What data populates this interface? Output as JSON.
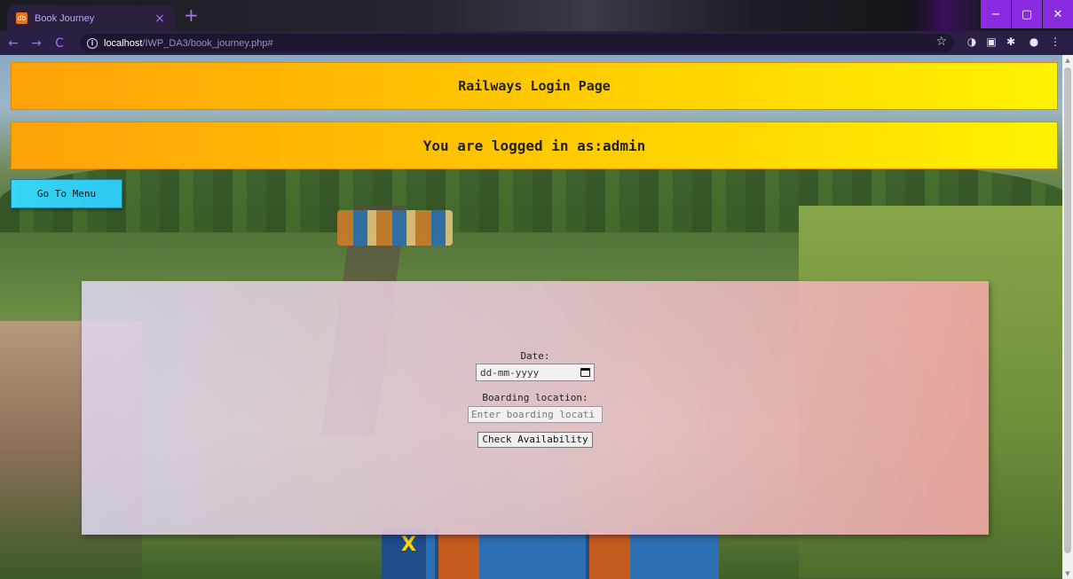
{
  "browser": {
    "tab_title": "Book Journey",
    "tab_favicon": "db",
    "tab_close": "×",
    "new_tab": "+",
    "url_host": "localhost",
    "url_path": "/IWP_DA3/book_journey.php#",
    "nav": {
      "back": "←",
      "forward": "→",
      "reload": "C"
    },
    "window": {
      "minimize": "−",
      "maximize": "▢",
      "close": "✕"
    },
    "colors": {
      "accent": "#8a2be2",
      "tab_text": "#b9a6ff"
    }
  },
  "page": {
    "title_banner": "Railways Login Page",
    "login_banner": "You are logged in as:admin",
    "menu_button": "Go To Menu",
    "form": {
      "date_label": "Date:",
      "date_placeholder": "dd-mm-yyyy",
      "boarding_label": "Boarding location:",
      "boarding_placeholder": "Enter boarding locati",
      "submit_label": "Check Availability"
    },
    "colors": {
      "banner_start": "#ffa20a",
      "banner_end": "#fff200",
      "menu_button": "#36d6f6",
      "card_left": "#ddd6ee",
      "card_right": "#f4a8a8"
    }
  }
}
